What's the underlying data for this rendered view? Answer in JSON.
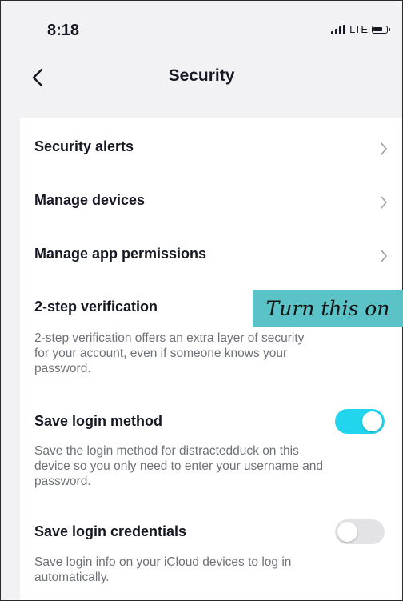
{
  "status_bar": {
    "time": "8:18",
    "carrier": "LTE"
  },
  "nav": {
    "title": "Security"
  },
  "menu_items": [
    {
      "label": "Security alerts"
    },
    {
      "label": "Manage devices"
    },
    {
      "label": "Manage app permissions"
    }
  ],
  "two_step": {
    "label": "2-step verification",
    "description_lines": [
      "2-step verification offers an extra layer of security",
      "for your account, even if someone knows your",
      "password."
    ]
  },
  "save_login_method": {
    "label": "Save login method",
    "enabled": true,
    "description_lines": [
      "Save the login method for distractedduck on this",
      "device so you only need to enter your username and",
      "password."
    ]
  },
  "save_login_credentials": {
    "label": "Save login credentials",
    "enabled": false,
    "description_lines": [
      "Save login info on your iCloud devices to log in",
      "automatically."
    ]
  },
  "callout": {
    "text": "Turn this on"
  },
  "colors": {
    "toggle_on": "#20d5ec",
    "toggle_off": "#e3e3e6",
    "callout_bg": "#5bc3c7",
    "chevron": "#9a9ba0"
  }
}
